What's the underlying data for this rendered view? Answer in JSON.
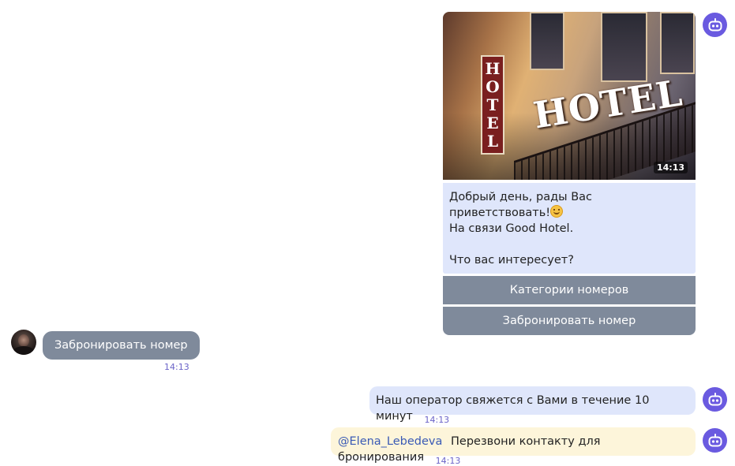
{
  "colors": {
    "bot_avatar": "#6a5ae0",
    "bot_bubble": "#dfe6fb",
    "quick_button": "#7f8a9b",
    "operator_note_bubble": "#fdf5da",
    "timestamp": "#6a63c8",
    "mention": "#3a5ab5"
  },
  "icons": {
    "bot_avatar": "robot-icon",
    "user_avatar": "user-photo",
    "emoji": "smiling-face-emoji"
  },
  "hotel_card": {
    "photo_alt": "HOTEL",
    "sign_vertical": [
      "H",
      "O",
      "T",
      "E",
      "L"
    ],
    "sign_horizontal": "HOTEL",
    "photo_time": "14:13",
    "greeting_line1": "Добрый день, рады Вас приветствовать!",
    "greeting_line2": "На связи Good Hotel.",
    "question": "Что вас интересует?",
    "quick_replies": [
      "Категории номеров",
      "Забронировать номер"
    ]
  },
  "user_message": {
    "text": "Забронировать номер",
    "time": "14:13"
  },
  "bot_message": {
    "text": "Наш оператор свяжется с Вами в течение 10 минут",
    "time": "14:13"
  },
  "operator_note": {
    "mention": "@Elena_Lebedeva",
    "text": "Перезвони контакту для бронирования",
    "time": "14:13"
  }
}
